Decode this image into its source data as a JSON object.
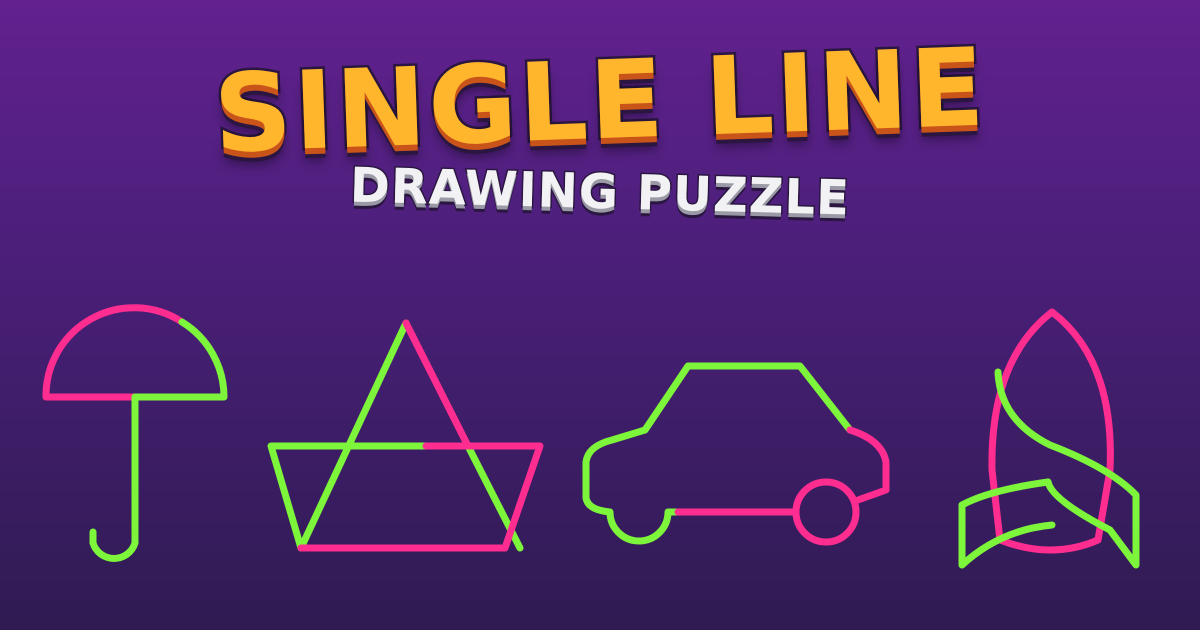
{
  "logo": {
    "title": "SINGLE LINE",
    "subtitle": "DRAWING PUZZLE"
  },
  "colors": {
    "pink": "#ff2d8f",
    "green": "#7cf53a",
    "title_orange": "#ffb52c",
    "background_top": "#62218f",
    "background_bottom": "#2f1b52"
  },
  "puzzles": [
    {
      "name": "umbrella"
    },
    {
      "name": "boat"
    },
    {
      "name": "car"
    },
    {
      "name": "rocket"
    }
  ]
}
